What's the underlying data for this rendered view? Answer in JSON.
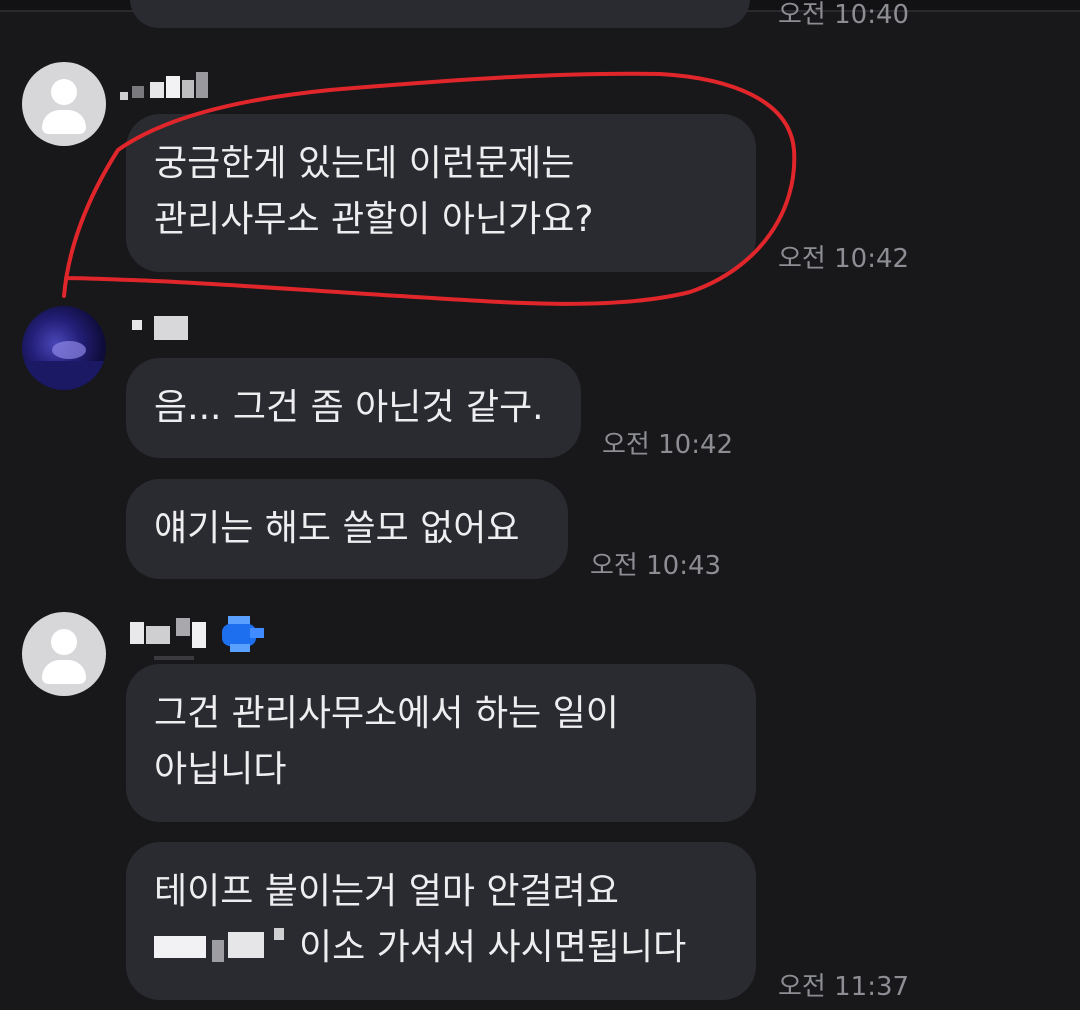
{
  "messages": [
    {
      "text_lines": [],
      "time": "오전 10:40"
    },
    {
      "text_lines": [
        "궁금한게 있는데 이런문제는",
        "관리사무소 관할이 아닌가요?"
      ],
      "time": "오전 10:42"
    },
    {
      "text_lines": [
        "음... 그건 좀 아닌것 같구."
      ],
      "time": "오전 10:42"
    },
    {
      "text_lines": [
        "얘기는 해도 쓸모 없어요"
      ],
      "time": "오전 10:43"
    },
    {
      "text_lines": [
        "그건 관리사무소에서 하는 일이",
        "아닙니다"
      ]
    },
    {
      "text_lines": [
        "테이프 붙이는거 얼마 안걸려요",
        "이소 가셔서 사시면됩니다"
      ],
      "time": "오전 11:37"
    }
  ],
  "colors": {
    "background": "#18181b",
    "bubble": "#2a2b31",
    "time_text": "#8d8e93",
    "annotation": "#e0262a"
  },
  "icons": [
    "default-profile-icon",
    "profile-photo",
    "verified-badge-icon"
  ]
}
